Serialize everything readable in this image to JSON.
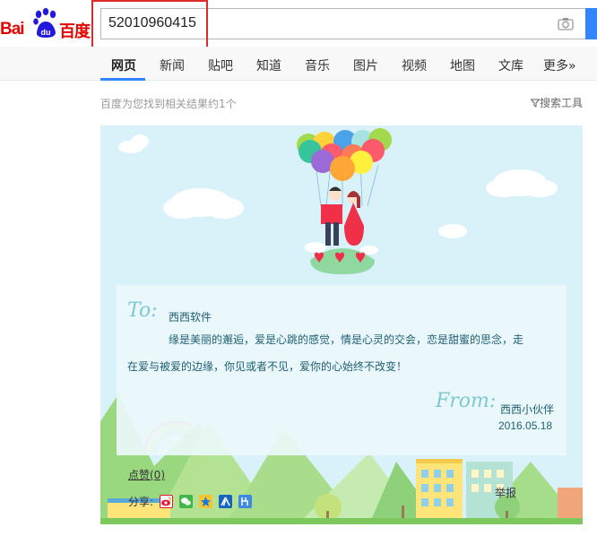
{
  "logo": {
    "text_latin": "Bai",
    "text_du": "du",
    "text_cn": "百度"
  },
  "search": {
    "query": "52010960415"
  },
  "nav": {
    "tabs": [
      {
        "label": "网页",
        "active": true
      },
      {
        "label": "新闻"
      },
      {
        "label": "贴吧"
      },
      {
        "label": "知道"
      },
      {
        "label": "音乐"
      },
      {
        "label": "图片"
      },
      {
        "label": "视频"
      },
      {
        "label": "地图"
      },
      {
        "label": "文库"
      },
      {
        "label": "更多»"
      }
    ]
  },
  "results": {
    "count_text": "百度为您找到相关结果约1个",
    "tools_label": "搜索工具"
  },
  "card": {
    "to_label": "To:",
    "recipient": "西西软件",
    "paragraph1": "缘是美丽的邂逅，爱是心跳的感觉，情是心灵的交会，恋是甜蜜的思念，走",
    "paragraph2": "在爱与被爱的边缘，你见或者不见，爱你的心始终不改变！",
    "from_label": "From:",
    "sender": "西西小伙伴",
    "date": "2016.05.18",
    "likes": "点赞(0)",
    "share_label": "分享:",
    "share_icons": [
      "weibo-icon",
      "wechat-icon",
      "qzone-icon",
      "renren-icon",
      "tieba-icon"
    ],
    "report": "举报"
  },
  "colors": {
    "brand_red": "#e10602",
    "brand_blue": "#2319dc",
    "accent_blue": "#3385ff",
    "highlight_red": "#dd2a2a",
    "card_bg": "#d9f2f9"
  }
}
